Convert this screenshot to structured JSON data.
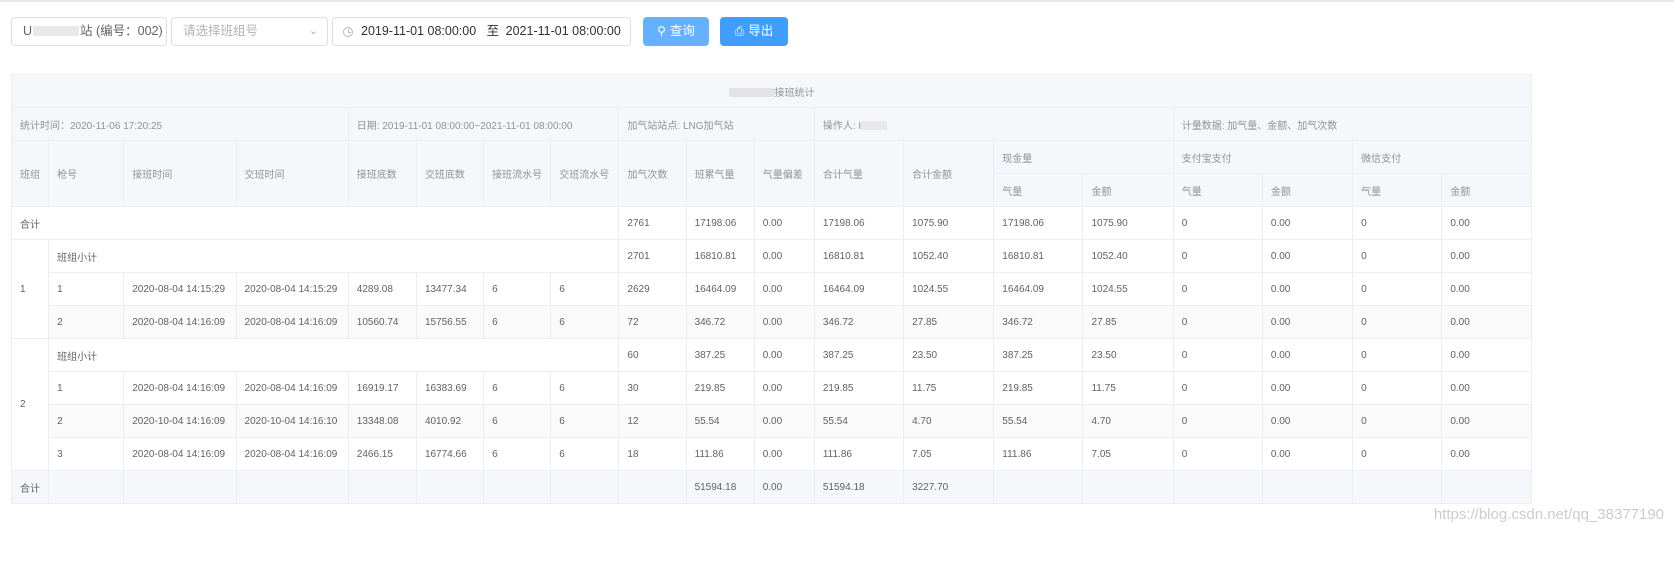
{
  "toolbar": {
    "station_prefix": "U",
    "station_suffix": "站 (编号：002)",
    "class_placeholder": "请选择班组号",
    "date_start": "2019-11-01 08:00:00",
    "date_sep": "至",
    "date_end": "2021-11-01 08:00:00",
    "query_label": "查询",
    "export_label": "导出"
  },
  "report": {
    "title_suffix": "接班统计",
    "stat_time": "统计时间：2020-11-06 17:20:25",
    "date_range": "日期: 2019-11-01 08:00:00~2021-11-01 08:00:00",
    "station": "加气站站点: LNG加气站",
    "operator": "操作人: I",
    "metrics": "计量数据: 加气量、金额、加气次数"
  },
  "headers": {
    "group": "班组",
    "gun": "枪号",
    "start_time": "接班时间",
    "end_time": "交班时间",
    "start_reading": "接班底数",
    "end_reading": "交班底数",
    "start_serial": "接班流水号",
    "end_serial": "交班流水号",
    "fill_count": "加气次数",
    "shift_gas": "班累气量",
    "gas_diff": "气量偏差",
    "total_gas": "合计气量",
    "total_amount": "合计金额",
    "cash": "现金量",
    "alipay": "支付宝支付",
    "wechat": "微信支付",
    "gas": "气量",
    "amount": "金额"
  },
  "rows": {
    "total_top": {
      "label": "合计",
      "count": "2761",
      "shift": "17198.06",
      "diff": "0.00",
      "tgas": "17198.06",
      "tamt": "1075.90",
      "cgas": "17198.06",
      "camt": "1075.90",
      "agas": "0",
      "aamt": "0.00",
      "wgas": "0",
      "wamt": "0.00"
    },
    "g1": {
      "group": "1",
      "sub": {
        "label": "班组小计",
        "count": "2701",
        "shift": "16810.81",
        "diff": "0.00",
        "tgas": "16810.81",
        "tamt": "1052.40",
        "cgas": "16810.81",
        "camt": "1052.40",
        "agas": "0",
        "aamt": "0.00",
        "wgas": "0",
        "wamt": "0.00"
      },
      "r1": {
        "gun": "1",
        "st": "2020-08-04 14:15:29",
        "et": "2020-08-04 14:15:29",
        "sr": "4289.08",
        "er": "13477.34",
        "ss": "6",
        "es": "6",
        "count": "2629",
        "shift": "16464.09",
        "diff": "0.00",
        "tgas": "16464.09",
        "tamt": "1024.55",
        "cgas": "16464.09",
        "camt": "1024.55",
        "agas": "0",
        "aamt": "0.00",
        "wgas": "0",
        "wamt": "0.00"
      },
      "r2": {
        "gun": "2",
        "st": "2020-08-04 14:16:09",
        "et": "2020-08-04 14:16:09",
        "sr": "10560.74",
        "er": "15756.55",
        "ss": "6",
        "es": "6",
        "count": "72",
        "shift": "346.72",
        "diff": "0.00",
        "tgas": "346.72",
        "tamt": "27.85",
        "cgas": "346.72",
        "camt": "27.85",
        "agas": "0",
        "aamt": "0.00",
        "wgas": "0",
        "wamt": "0.00"
      }
    },
    "g2": {
      "group": "2",
      "sub": {
        "label": "班组小计",
        "count": "60",
        "shift": "387.25",
        "diff": "0.00",
        "tgas": "387.25",
        "tamt": "23.50",
        "cgas": "387.25",
        "camt": "23.50",
        "agas": "0",
        "aamt": "0.00",
        "wgas": "0",
        "wamt": "0.00"
      },
      "r1": {
        "gun": "1",
        "st": "2020-08-04 14:16:09",
        "et": "2020-08-04 14:16:09",
        "sr": "16919.17",
        "er": "16383.69",
        "ss": "6",
        "es": "6",
        "count": "30",
        "shift": "219.85",
        "diff": "0.00",
        "tgas": "219.85",
        "tamt": "11.75",
        "cgas": "219.85",
        "camt": "11.75",
        "agas": "0",
        "aamt": "0.00",
        "wgas": "0",
        "wamt": "0.00"
      },
      "r2": {
        "gun": "2",
        "st": "2020-10-04 14:16:09",
        "et": "2020-10-04 14:16:10",
        "sr": "13348.08",
        "er": "4010.92",
        "ss": "6",
        "es": "6",
        "count": "12",
        "shift": "55.54",
        "diff": "0.00",
        "tgas": "55.54",
        "tamt": "4.70",
        "cgas": "55.54",
        "camt": "4.70",
        "agas": "0",
        "aamt": "0.00",
        "wgas": "0",
        "wamt": "0.00"
      },
      "r3": {
        "gun": "3",
        "st": "2020-08-04 14:16:09",
        "et": "2020-08-04 14:16:09",
        "sr": "2466.15",
        "er": "16774.66",
        "ss": "6",
        "es": "6",
        "count": "18",
        "shift": "111.86",
        "diff": "0.00",
        "tgas": "111.86",
        "tamt": "7.05",
        "cgas": "111.86",
        "camt": "7.05",
        "agas": "0",
        "aamt": "0.00",
        "wgas": "0",
        "wamt": "0.00"
      }
    },
    "total_bottom": {
      "label": "合计",
      "shift": "51594.18",
      "diff": "0.00",
      "tgas": "51594.18",
      "tamt": "3227.70"
    }
  },
  "watermark": "https://blog.csdn.net/qq_38377190"
}
